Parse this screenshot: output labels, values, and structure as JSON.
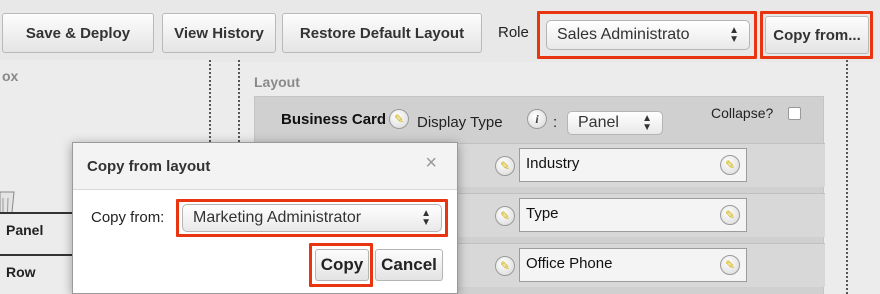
{
  "toolbar": {
    "save_deploy": "Save & Deploy",
    "view_history": "View History",
    "restore_default": "Restore Default Layout",
    "role_label": "Role",
    "role_value": "Sales Administrato",
    "copy_from": "Copy from..."
  },
  "toolbox": {
    "title": "ox",
    "items": [
      "Panel",
      "Row"
    ]
  },
  "layout": {
    "title": "Layout",
    "panel_name": "Business Card",
    "display_type_label": "Display Type",
    "display_type_colon": ":",
    "display_type_value": "Panel",
    "collapse_label": "Collapse?",
    "fields": [
      "Industry",
      "Type",
      "Office Phone"
    ]
  },
  "dialog": {
    "title": "Copy from layout",
    "close": "×",
    "copy_from_label": "Copy from:",
    "copy_from_value": "Marketing Administrator",
    "copy_button": "Copy",
    "cancel_button": "Cancel"
  },
  "colors": {
    "highlight": "#e8340f",
    "panel_bg": "#d0d0d0"
  }
}
